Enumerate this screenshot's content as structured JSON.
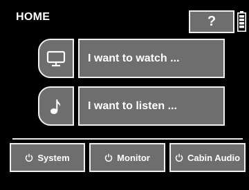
{
  "header": {
    "title": "HOME",
    "help_label": "?"
  },
  "main": {
    "actions": [
      {
        "label": "I want to watch ...",
        "icon": "monitor-icon"
      },
      {
        "label": "I want to listen ...",
        "icon": "music-note-icon"
      }
    ]
  },
  "footer": {
    "buttons": [
      {
        "label": "System",
        "icon": "power-icon"
      },
      {
        "label": "Monitor",
        "icon": "power-icon"
      },
      {
        "label": "Cabin Audio",
        "icon": "power-icon"
      }
    ]
  },
  "colors": {
    "background": "#000000",
    "button_fill": "#6e6e6e",
    "border": "#f0f0f0",
    "text": "#ffffff"
  }
}
